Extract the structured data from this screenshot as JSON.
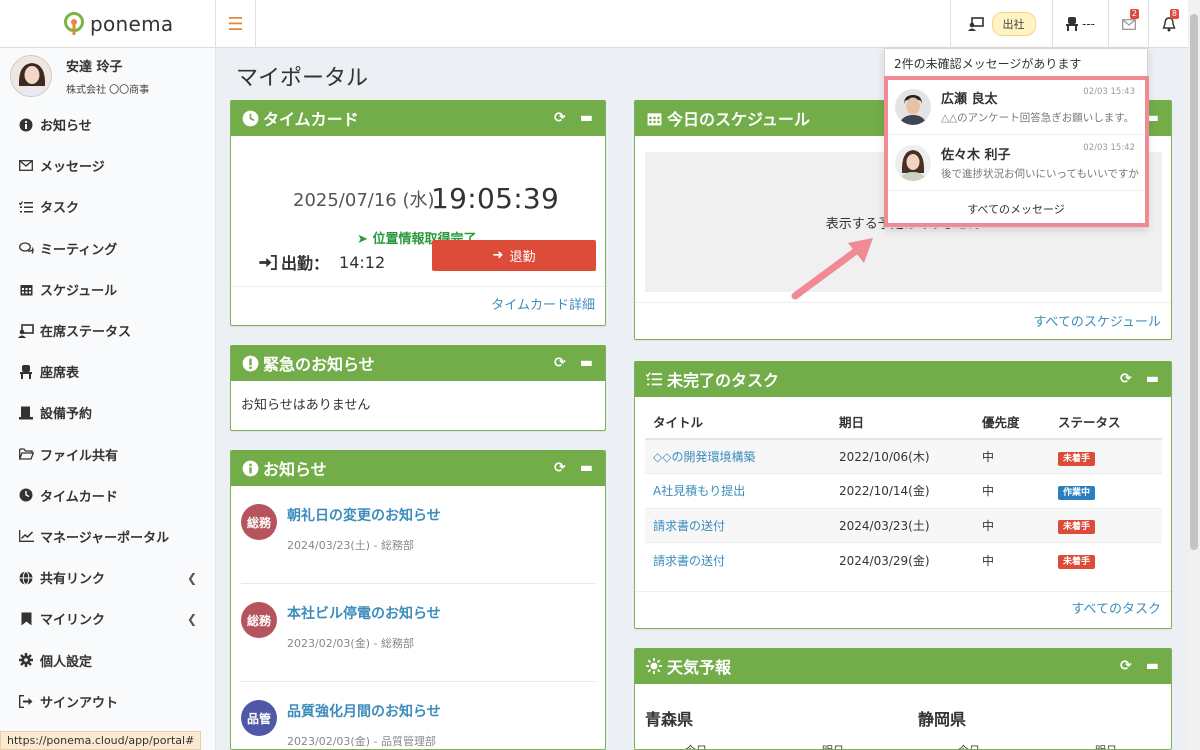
{
  "app": {
    "logo_text": "ponema"
  },
  "header": {
    "presence_status": "出社",
    "seat_text": "---",
    "message_count": "2",
    "notification_count": "8"
  },
  "user": {
    "name": "安達 玲子",
    "company": "株式会社 〇〇商事"
  },
  "sidebar": {
    "items": [
      {
        "label": "お知らせ",
        "icon": "info-circle-icon"
      },
      {
        "label": "メッセージ",
        "icon": "envelope-icon"
      },
      {
        "label": "タスク",
        "icon": "task-list-icon"
      },
      {
        "label": "ミーティング",
        "icon": "comments-icon"
      },
      {
        "label": "スケジュール",
        "icon": "calendar-icon"
      },
      {
        "label": "在席ステータス",
        "icon": "presence-icon"
      },
      {
        "label": "座席表",
        "icon": "chair-icon"
      },
      {
        "label": "設備予約",
        "icon": "equipment-icon"
      },
      {
        "label": "ファイル共有",
        "icon": "folder-icon"
      },
      {
        "label": "タイムカード",
        "icon": "clock-icon"
      },
      {
        "label": "マネージャーポータル",
        "icon": "chart-line-icon"
      },
      {
        "label": "共有リンク",
        "icon": "globe-icon"
      },
      {
        "label": "マイリンク",
        "icon": "bookmark-icon"
      },
      {
        "label": "個人設定",
        "icon": "gear-icon"
      },
      {
        "label": "サインアウト",
        "icon": "sign-out-icon"
      }
    ]
  },
  "status_bar_url": "https://ponema.cloud/app/portal#",
  "page_title": "マイポータル",
  "timecard": {
    "title": "タイムカード",
    "date": "2025/07/16 (水)",
    "time": "19:05:39",
    "location_status": "位置情報取得完了",
    "clock_in_label": "出勤：",
    "clock_in_time": "14:12",
    "clock_out_button": "退勤",
    "footer_link": "タイムカード詳細"
  },
  "emergency": {
    "title": "緊急のお知らせ",
    "empty_text": "お知らせはありません"
  },
  "notices": {
    "title": "お知らせ",
    "items": [
      {
        "category": "総務",
        "title": "朝礼日の変更のお知らせ",
        "meta": "2024/03/23(土) - 総務部",
        "color": "#b5545c"
      },
      {
        "category": "総務",
        "title": "本社ビル停電のお知らせ",
        "meta": "2023/02/03(金) - 総務部",
        "color": "#b5545c"
      },
      {
        "category": "品管",
        "title": "品質強化月間のお知らせ",
        "meta": "2023/02/03(金) - 品質管理部",
        "color": "#4e58a6"
      }
    ]
  },
  "schedule": {
    "title": "今日のスケジュール",
    "empty_text": "表示する予定はありません",
    "footer_link": "すべてのスケジュール"
  },
  "tasks": {
    "title": "未完了のタスク",
    "columns": [
      "タイトル",
      "期日",
      "優先度",
      "ステータス"
    ],
    "rows": [
      {
        "title": "◇◇の開発環境構築",
        "due": "2022/10/06(木)",
        "priority": "中",
        "status": "未着手",
        "status_color": "#dd4b39"
      },
      {
        "title": "A社見積もり提出",
        "due": "2022/10/14(金)",
        "priority": "中",
        "status": "作業中",
        "status_color": "#2a7fbf"
      },
      {
        "title": "請求書の送付",
        "due": "2024/03/23(土)",
        "priority": "中",
        "status": "未着手",
        "status_color": "#dd4b39"
      },
      {
        "title": "請求書の送付",
        "due": "2024/03/29(金)",
        "priority": "中",
        "status": "未着手",
        "status_color": "#dd4b39"
      }
    ],
    "footer_link": "すべてのタスク"
  },
  "weather": {
    "title": "天気予報",
    "prefectures": [
      {
        "name": "青森県",
        "days": [
          "今日",
          "明日"
        ]
      },
      {
        "name": "静岡県",
        "days": [
          "今日",
          "明日"
        ]
      }
    ]
  },
  "messages_dropdown": {
    "header": "2件の未確認メッセージがあります",
    "items": [
      {
        "sender": "広瀬 良太",
        "time": "02/03 15:43",
        "preview": "△△のアンケート回答急ぎお願いします。"
      },
      {
        "sender": "佐々木 利子",
        "time": "02/03 15:42",
        "preview": "後で進捗状況お伺いにいってもいいですか"
      }
    ],
    "footer": "すべてのメッセージ"
  },
  "colors": {
    "box_header": "#72ad49",
    "link": "#3c8dbc",
    "danger": "#dd4b39",
    "highlight": "#f08a95"
  }
}
